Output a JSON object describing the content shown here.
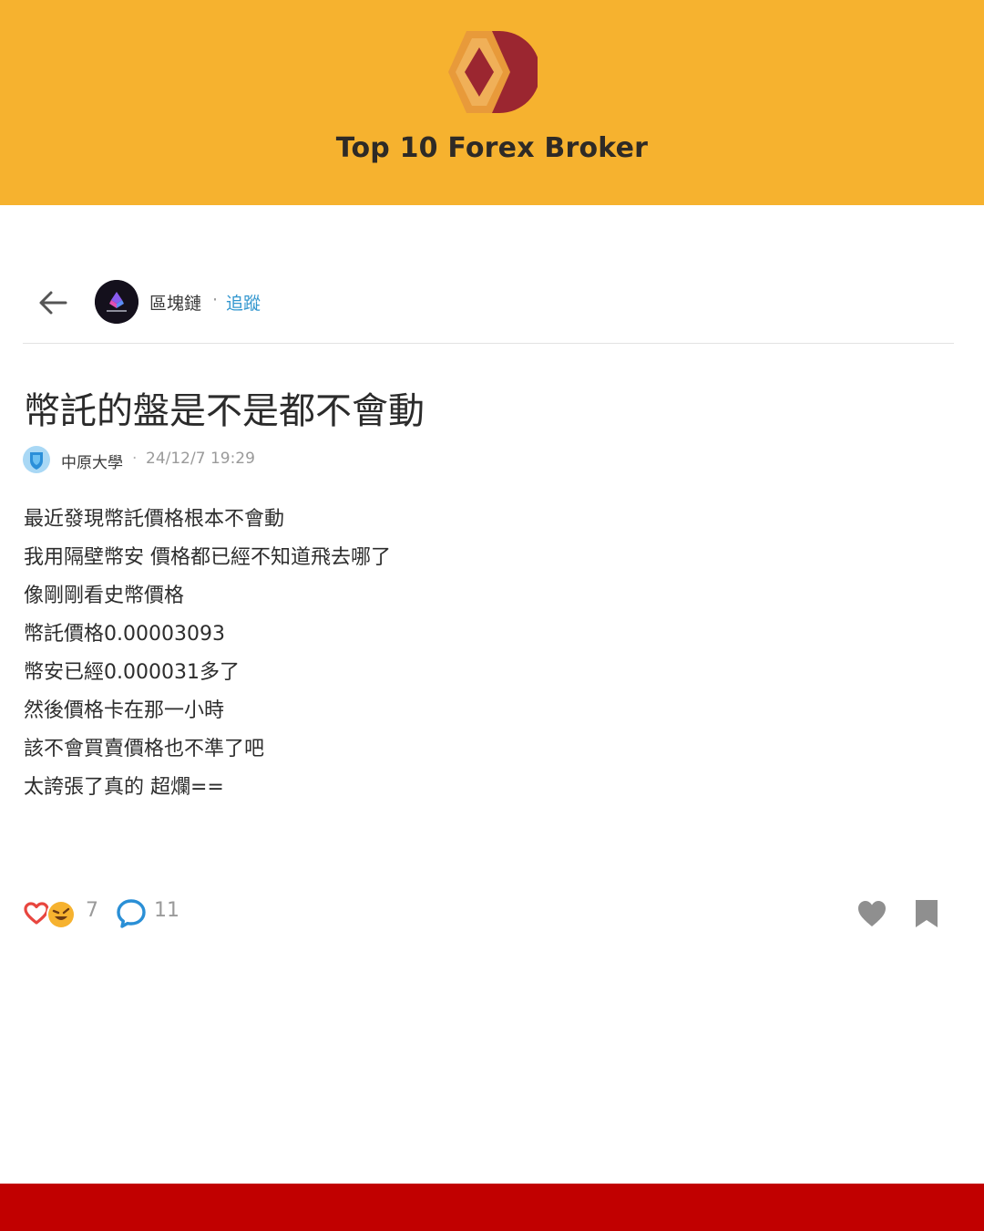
{
  "brand": {
    "title": "Top 10 Forex Broker",
    "banner_color": "#f6b22f",
    "logo_icon": "hive-logo-icon"
  },
  "header": {
    "back_icon": "arrow-left-icon",
    "board_name": "區塊鏈",
    "separator": "·",
    "follow_label": "追蹤",
    "follow_color": "#3397cf"
  },
  "post": {
    "title": "幣託的盤是不是都不會動",
    "author": {
      "school": "中原大學",
      "separator": "·",
      "time": "24/12/7 19:29"
    },
    "lines": [
      "最近發現幣託價格根本不會動",
      "我用隔壁幣安 價格都已經不知道飛去哪了",
      "像剛剛看史幣價格",
      "幣託價格0.00003093",
      "幣安已經0.000031多了",
      "然後價格卡在那一小時",
      "該不會買賣價格也不準了吧",
      "太誇張了真的 超爛=="
    ]
  },
  "footer": {
    "reaction_icons": [
      "heart-reaction-icon",
      "laugh-reaction-icon"
    ],
    "reaction_count": "7",
    "comment_icon": "comment-icon",
    "comment_count": "11",
    "like_icon": "heart-icon",
    "bookmark_icon": "bookmark-icon"
  },
  "bottom_bar_color": "#c10000"
}
